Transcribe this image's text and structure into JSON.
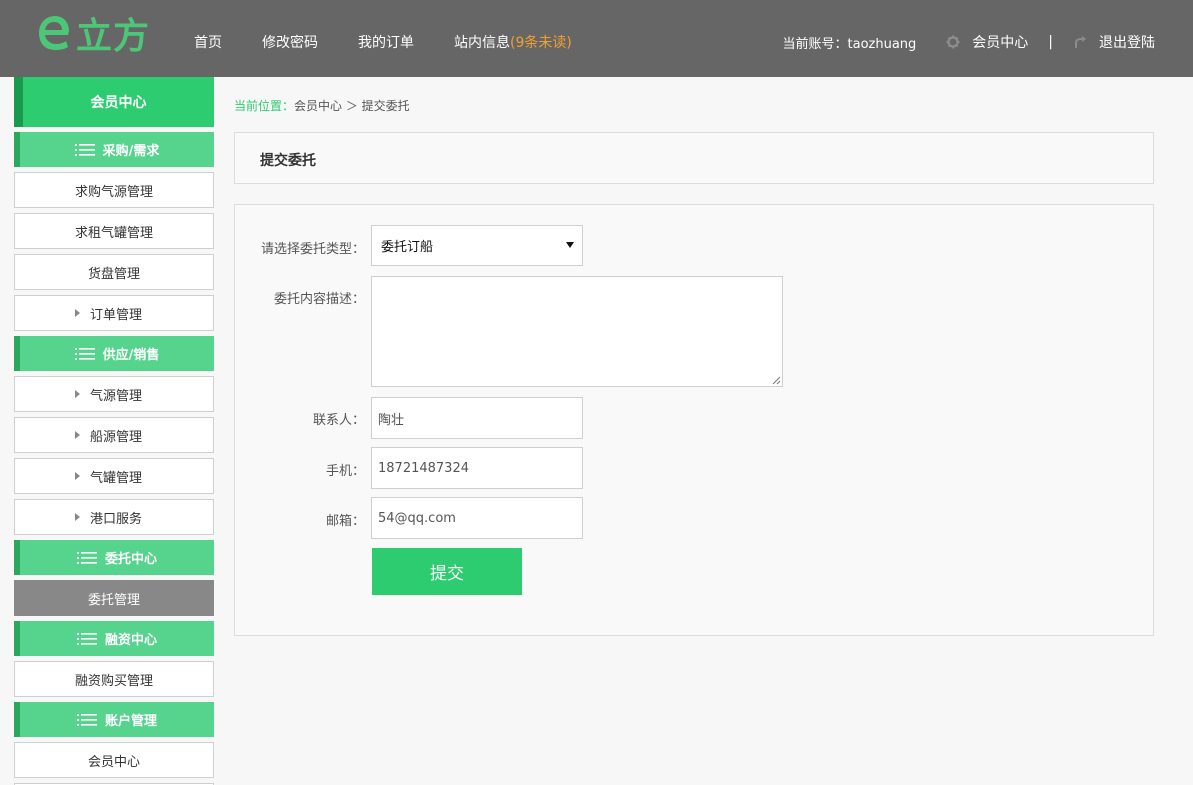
{
  "header": {
    "logo_text": "立方",
    "nav": [
      "首页",
      "修改密码",
      "我的订单"
    ],
    "messages_label": "站内信息",
    "messages_unread": "(9条未读)",
    "account_label": "当前账号：taozhuang",
    "member_center": "会员中心",
    "separator": "|",
    "logout": "退出登陆"
  },
  "sidebar": {
    "title": "会员中心",
    "groups": [
      {
        "label": "采购/需求",
        "items": [
          "求购气源管理",
          "求租气罐管理",
          "货盘管理",
          "订单管理"
        ]
      },
      {
        "label": "供应/销售",
        "items": [
          "气源管理",
          "船源管理",
          "气罐管理",
          "港口服务"
        ]
      },
      {
        "label": "委托中心",
        "items": [
          "委托管理"
        ]
      },
      {
        "label": "融资中心",
        "items": [
          "融资购买管理"
        ]
      },
      {
        "label": "账户管理",
        "items": [
          "会员中心"
        ]
      }
    ]
  },
  "breadcrumb": {
    "label": "当前位置：",
    "path": "会员中心 ＞ 提交委托"
  },
  "panel": {
    "title": "提交委托"
  },
  "form": {
    "type_label": "请选择委托类型：",
    "type_value": "委托订船",
    "desc_label": "委托内容描述：",
    "desc_value": "",
    "contact_label": "联系人：",
    "contact_value": "陶壮",
    "phone_label": "手机：",
    "phone_value": "18721487324",
    "email_label": "邮箱：",
    "email_value": "54@qq.com",
    "submit_label": "提交"
  },
  "colors": {
    "header_bg": "#666666",
    "brand_green": "#2ecc71",
    "group_green": "#56d48d",
    "unread_orange": "#f0a030",
    "active_gray": "#888888"
  },
  "icons": [
    "logo-e-icon",
    "gear-icon",
    "logout-arrow-icon",
    "menu-lines-icon",
    "caret-right-icon",
    "dropdown-caret-icon"
  ]
}
